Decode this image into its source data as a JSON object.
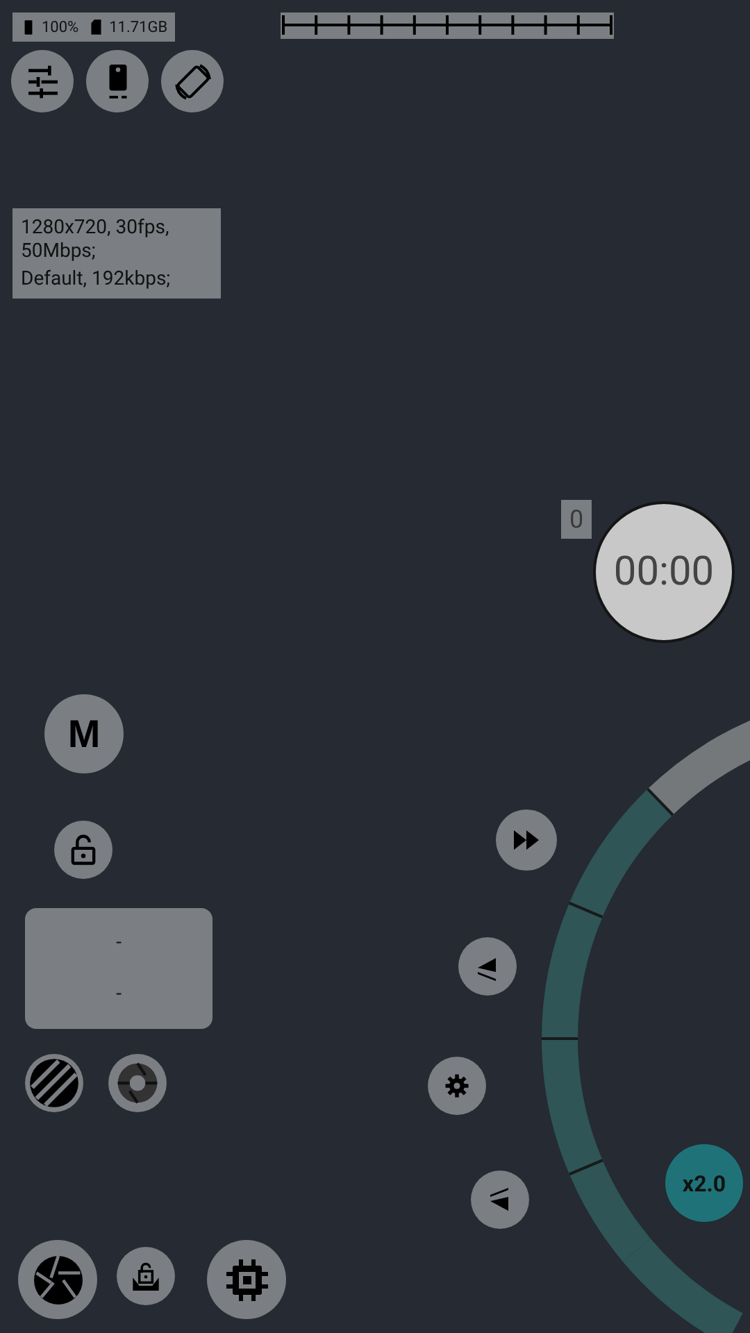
{
  "status": {
    "battery": "100%",
    "storage": "11.71GB"
  },
  "video_info": [
    "1280x720, 30fps, 50Mbps;",
    "Default, 192kbps;"
  ],
  "clip_count": "0",
  "timer": "00:00",
  "mode_button": "M",
  "exposure_panel": [
    "-",
    "-"
  ],
  "zoom_button": "x2.0"
}
